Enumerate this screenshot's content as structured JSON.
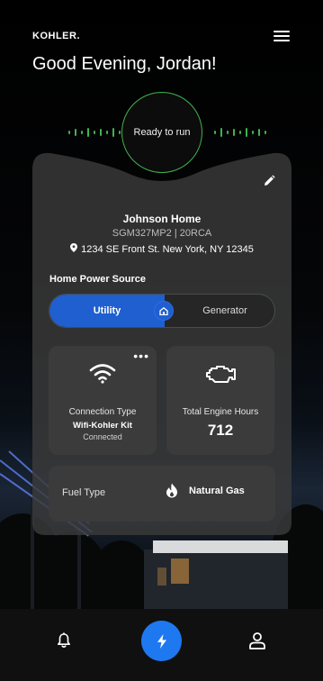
{
  "header": {
    "brand": "KOHLER.",
    "greeting": "Good Evening, Jordan!"
  },
  "status": {
    "label": "Ready to run",
    "accent": "#3fb34f"
  },
  "home": {
    "name": "Johnson Home",
    "model": "SGM327MP2 | 20RCA",
    "address": "1234 SE Front St. New York, NY 12345"
  },
  "power_source": {
    "title": "Home Power Source",
    "options": [
      "Utility",
      "Generator"
    ],
    "selected": "Utility",
    "accent": "#1f5fcf"
  },
  "connection": {
    "label": "Connection Type",
    "type": "Wifi-Kohler Kit",
    "state": "Connected",
    "more_label": "•••"
  },
  "engine": {
    "label": "Total Engine Hours",
    "value": "712"
  },
  "fuel": {
    "label": "Fuel Type",
    "value": "Natural Gas"
  },
  "nav": {
    "icons": [
      "bell-icon",
      "bolt-icon",
      "user-icon"
    ],
    "active_color": "#1e78f0"
  }
}
